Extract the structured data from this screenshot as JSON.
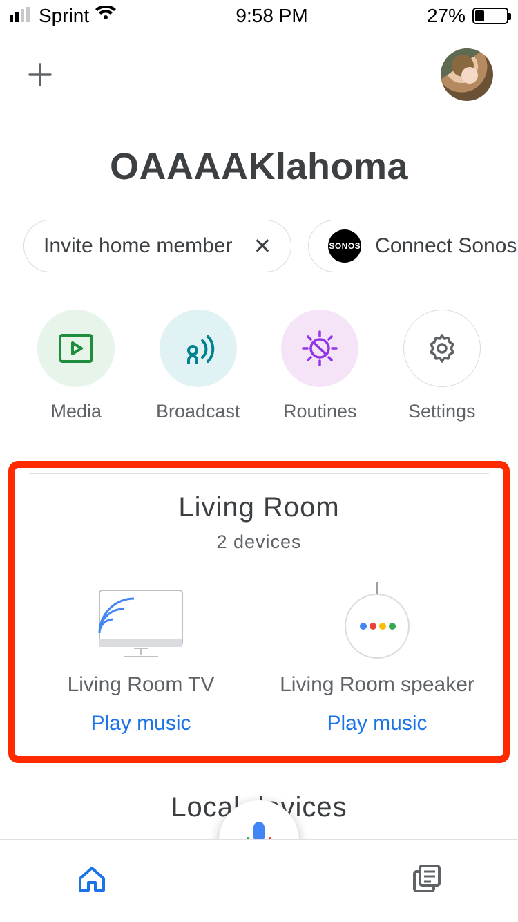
{
  "status": {
    "carrier": "Sprint",
    "time": "9:58 PM",
    "battery_pct": "27%"
  },
  "home": {
    "title": "OAAAAKlahoma"
  },
  "pills": {
    "invite": {
      "label": "Invite home member",
      "dismiss": "✕"
    },
    "sonos": {
      "badge": "SONOS",
      "label": "Connect Sonos"
    }
  },
  "quick_actions": {
    "media": "Media",
    "broadcast": "Broadcast",
    "routines": "Routines",
    "settings": "Settings"
  },
  "room": {
    "name": "Living Room",
    "subtitle": "2 devices",
    "devices": [
      {
        "name": "Living Room TV",
        "action": "Play music"
      },
      {
        "name": "Living Room speaker",
        "action": "Play music"
      }
    ]
  },
  "local": {
    "title": "Local devices"
  }
}
